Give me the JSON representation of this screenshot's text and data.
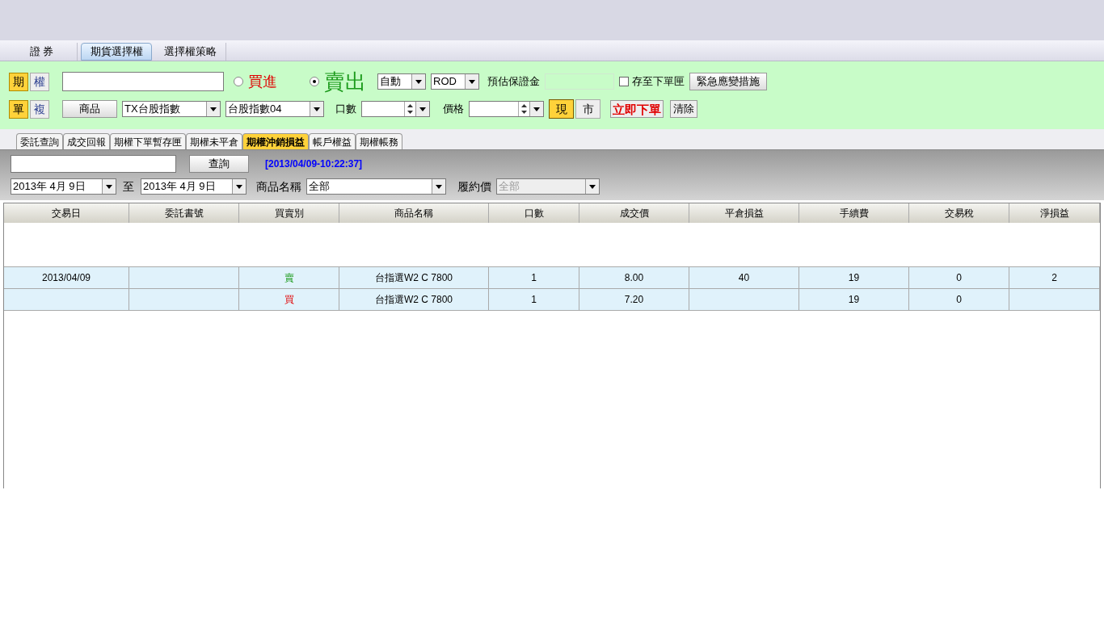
{
  "main_tabs": [
    {
      "label": "證 券",
      "selected": false
    },
    {
      "label": "期貨選擇權",
      "selected": true
    },
    {
      "label": "選擇權策略",
      "selected": false
    }
  ],
  "order_panel": {
    "market_toggle": [
      {
        "label": "期",
        "selected": true
      },
      {
        "label": "權",
        "selected": false
      }
    ],
    "side": [
      {
        "label": "買進",
        "selected": false,
        "kind": "buy"
      },
      {
        "label": "賣出",
        "selected": true,
        "kind": "sell"
      }
    ],
    "condition": "自動",
    "time_in_force": "ROD",
    "margin_label": "預估保證金",
    "save_to_box": {
      "label": "存至下單匣",
      "checked": false
    },
    "emergency_button": "緊急應變措施",
    "order_type_toggle": [
      {
        "label": "單",
        "selected": true
      },
      {
        "label": "複",
        "selected": false
      }
    ],
    "product_button": "商品",
    "product": "TX台股指數",
    "contract": "台股指數04",
    "quantity_label": "口數",
    "price_label": "價格",
    "price_type": [
      {
        "label": "現",
        "selected": true
      },
      {
        "label": "市",
        "selected": false
      }
    ],
    "submit_button": "立即下單",
    "clear_button": "清除"
  },
  "sub_tabs": [
    {
      "label": "委託查詢",
      "selected": false
    },
    {
      "label": "成交回報",
      "selected": false
    },
    {
      "label": "期權下單暫存匣",
      "selected": false
    },
    {
      "label": "期權未平倉",
      "selected": false
    },
    {
      "label": "期權沖銷損益",
      "selected": true
    },
    {
      "label": "帳戶權益",
      "selected": false
    },
    {
      "label": "期權帳務",
      "selected": false
    }
  ],
  "filters": {
    "query_button": "查詢",
    "timestamp": "[2013/04/09-10:22:37]",
    "date_from": "2013年  4月  9日",
    "to_label": "至",
    "date_to": "2013年  4月  9日",
    "product_label": "商品名稱",
    "product": "全部",
    "strike_label": "履約價",
    "strike": {
      "value": "全部",
      "disabled": true
    }
  },
  "table": {
    "columns": [
      "交易日",
      "委託書號",
      "買賣別",
      "商品名稱",
      "口數",
      "成交價",
      "平倉損益",
      "手續費",
      "交易稅",
      "淨損益"
    ],
    "rows": [
      {
        "date": "2013/04/09",
        "side": {
          "text": "賣",
          "kind": "sell"
        },
        "product": "台指選W2 C 7800",
        "qty": "1",
        "price": "8.00",
        "pnl": "40",
        "fee": "19",
        "tax": "0",
        "net": "2"
      },
      {
        "date": "",
        "side": {
          "text": "買",
          "kind": "buy"
        },
        "product": "台指選W2 C 7800",
        "qty": "1",
        "price": "7.20",
        "pnl": "",
        "fee": "19",
        "tax": "0",
        "net": ""
      }
    ]
  }
}
